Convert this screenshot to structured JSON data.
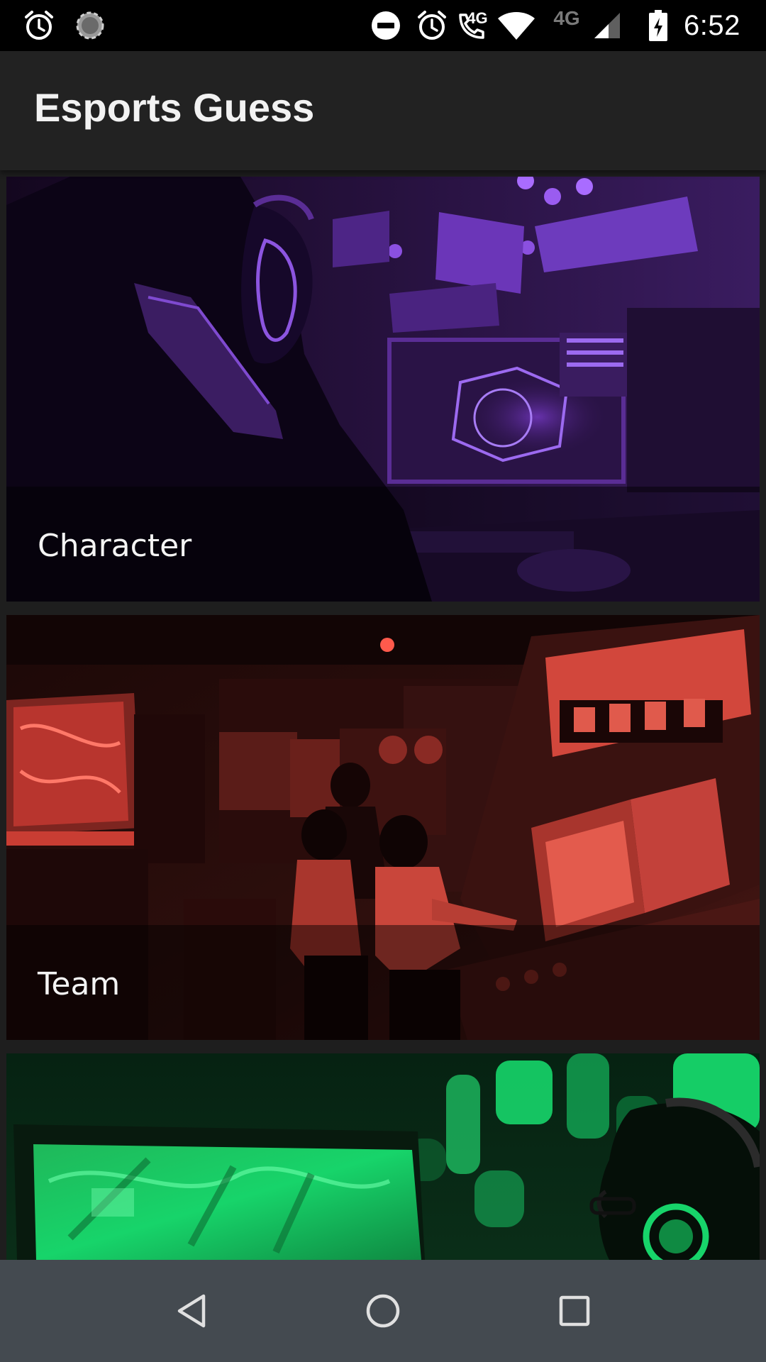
{
  "status_bar": {
    "time": "6:52",
    "network_label": "4G",
    "call_label": "4G",
    "icons": [
      "alarm-icon",
      "sync-icon",
      "do-not-disturb-icon",
      "alarm-icon",
      "wifi-calling-icon",
      "wifi-icon",
      "signal-icon",
      "battery-charging-icon"
    ]
  },
  "app_bar": {
    "title": "Esports Guess"
  },
  "categories": [
    {
      "label": "Character",
      "tint": "#7a3cc8"
    },
    {
      "label": "Team",
      "tint": "#d0463f"
    },
    {
      "label": "",
      "tint": "#17d46a"
    }
  ],
  "nav_bar": {
    "buttons": [
      "back-icon",
      "home-icon",
      "recents-icon"
    ]
  }
}
